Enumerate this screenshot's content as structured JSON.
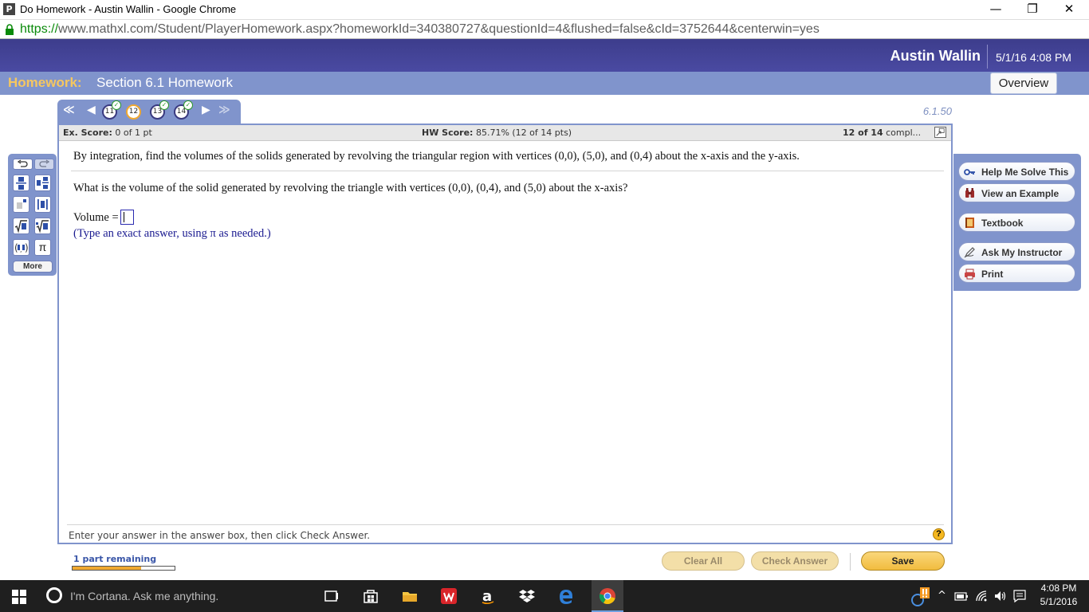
{
  "window": {
    "title": "Do Homework - Austin Wallin - Google Chrome",
    "app_icon_letter": "P",
    "minimize": "—",
    "restore": "❐",
    "close": "✕"
  },
  "address_bar": {
    "protocol": "https://",
    "rest": "www.mathxl.com/Student/PlayerHomework.aspx?homeworkId=340380727&questionId=4&flushed=false&cId=3752644&centerwin=yes"
  },
  "header": {
    "user_name": "Austin Wallin",
    "datetime": "5/1/16 4:08 PM"
  },
  "subheader": {
    "homework_label": "Homework:",
    "homework_title": "Section 6.1 Homework",
    "overview_label": "Overview"
  },
  "question_nav": {
    "first": "≪",
    "prev": "◀",
    "next": "▶",
    "last": "≫",
    "questions": [
      {
        "number": "11",
        "completed": true,
        "current": false
      },
      {
        "number": "12",
        "completed": false,
        "current": true
      },
      {
        "number": "13",
        "completed": true,
        "current": false
      },
      {
        "number": "14",
        "completed": true,
        "current": false
      }
    ],
    "question_id": "6.1.50"
  },
  "score_bar": {
    "ex_score_label": "Ex. Score:",
    "ex_score_value": "0 of 1 pt",
    "hw_score_label": "HW Score:",
    "hw_score_value": "85.71% (12 of 14 pts)",
    "complete_count_bold": "12 of 14",
    "complete_count_rest": "compl..."
  },
  "question": {
    "intro": "By integration, find the volumes of the solids generated by revolving the triangular region with vertices (0,0), (5,0), and (0,4) about the x-axis and the y-axis.",
    "text": "What is the volume of the solid generated by revolving the triangle with vertices (0,0), (0,4), and (5,0) about the x-axis?",
    "answer_label": "Volume =",
    "answer_value": "",
    "hint": "(Type an exact answer, using π as needed.)",
    "instruction": "Enter your answer in the answer box, then click Check Answer.",
    "help_symbol": "?"
  },
  "tool_palette": {
    "tools": [
      "undo-icon",
      "redo-icon",
      "fraction-icon",
      "mixed-number-icon",
      "superscript-icon",
      "absolute-value-icon",
      "sqrt-icon",
      "nth-root-icon",
      "ordered-pair-icon",
      "pi-icon"
    ],
    "pi_symbol": "π",
    "more_label": "More"
  },
  "help_panel": {
    "help_me_solve": "Help Me Solve This",
    "view_example": "View an Example",
    "textbook": "Textbook",
    "ask_instructor": "Ask My Instructor",
    "print": "Print"
  },
  "bottom_bar": {
    "parts_remaining": "1 part remaining",
    "progress_fraction": 0.67,
    "clear_all": "Clear All",
    "check_answer": "Check Answer",
    "save": "Save"
  },
  "taskbar": {
    "cortana_placeholder": "I'm Cortana. Ask me anything.",
    "time": "4:08 PM",
    "date": "5/1/2016",
    "apps": [
      "task-view-icon",
      "store-icon",
      "file-explorer-icon",
      "wps-office-icon",
      "amazon-icon",
      "dropbox-icon",
      "edge-icon",
      "chrome-icon"
    ]
  },
  "colors": {
    "header_bg": "#3d3d8c",
    "subheader_bg": "#8094cc",
    "homework_label": "#f5c760",
    "save_button": "#f1bc3f",
    "progress": "#f0a830"
  }
}
